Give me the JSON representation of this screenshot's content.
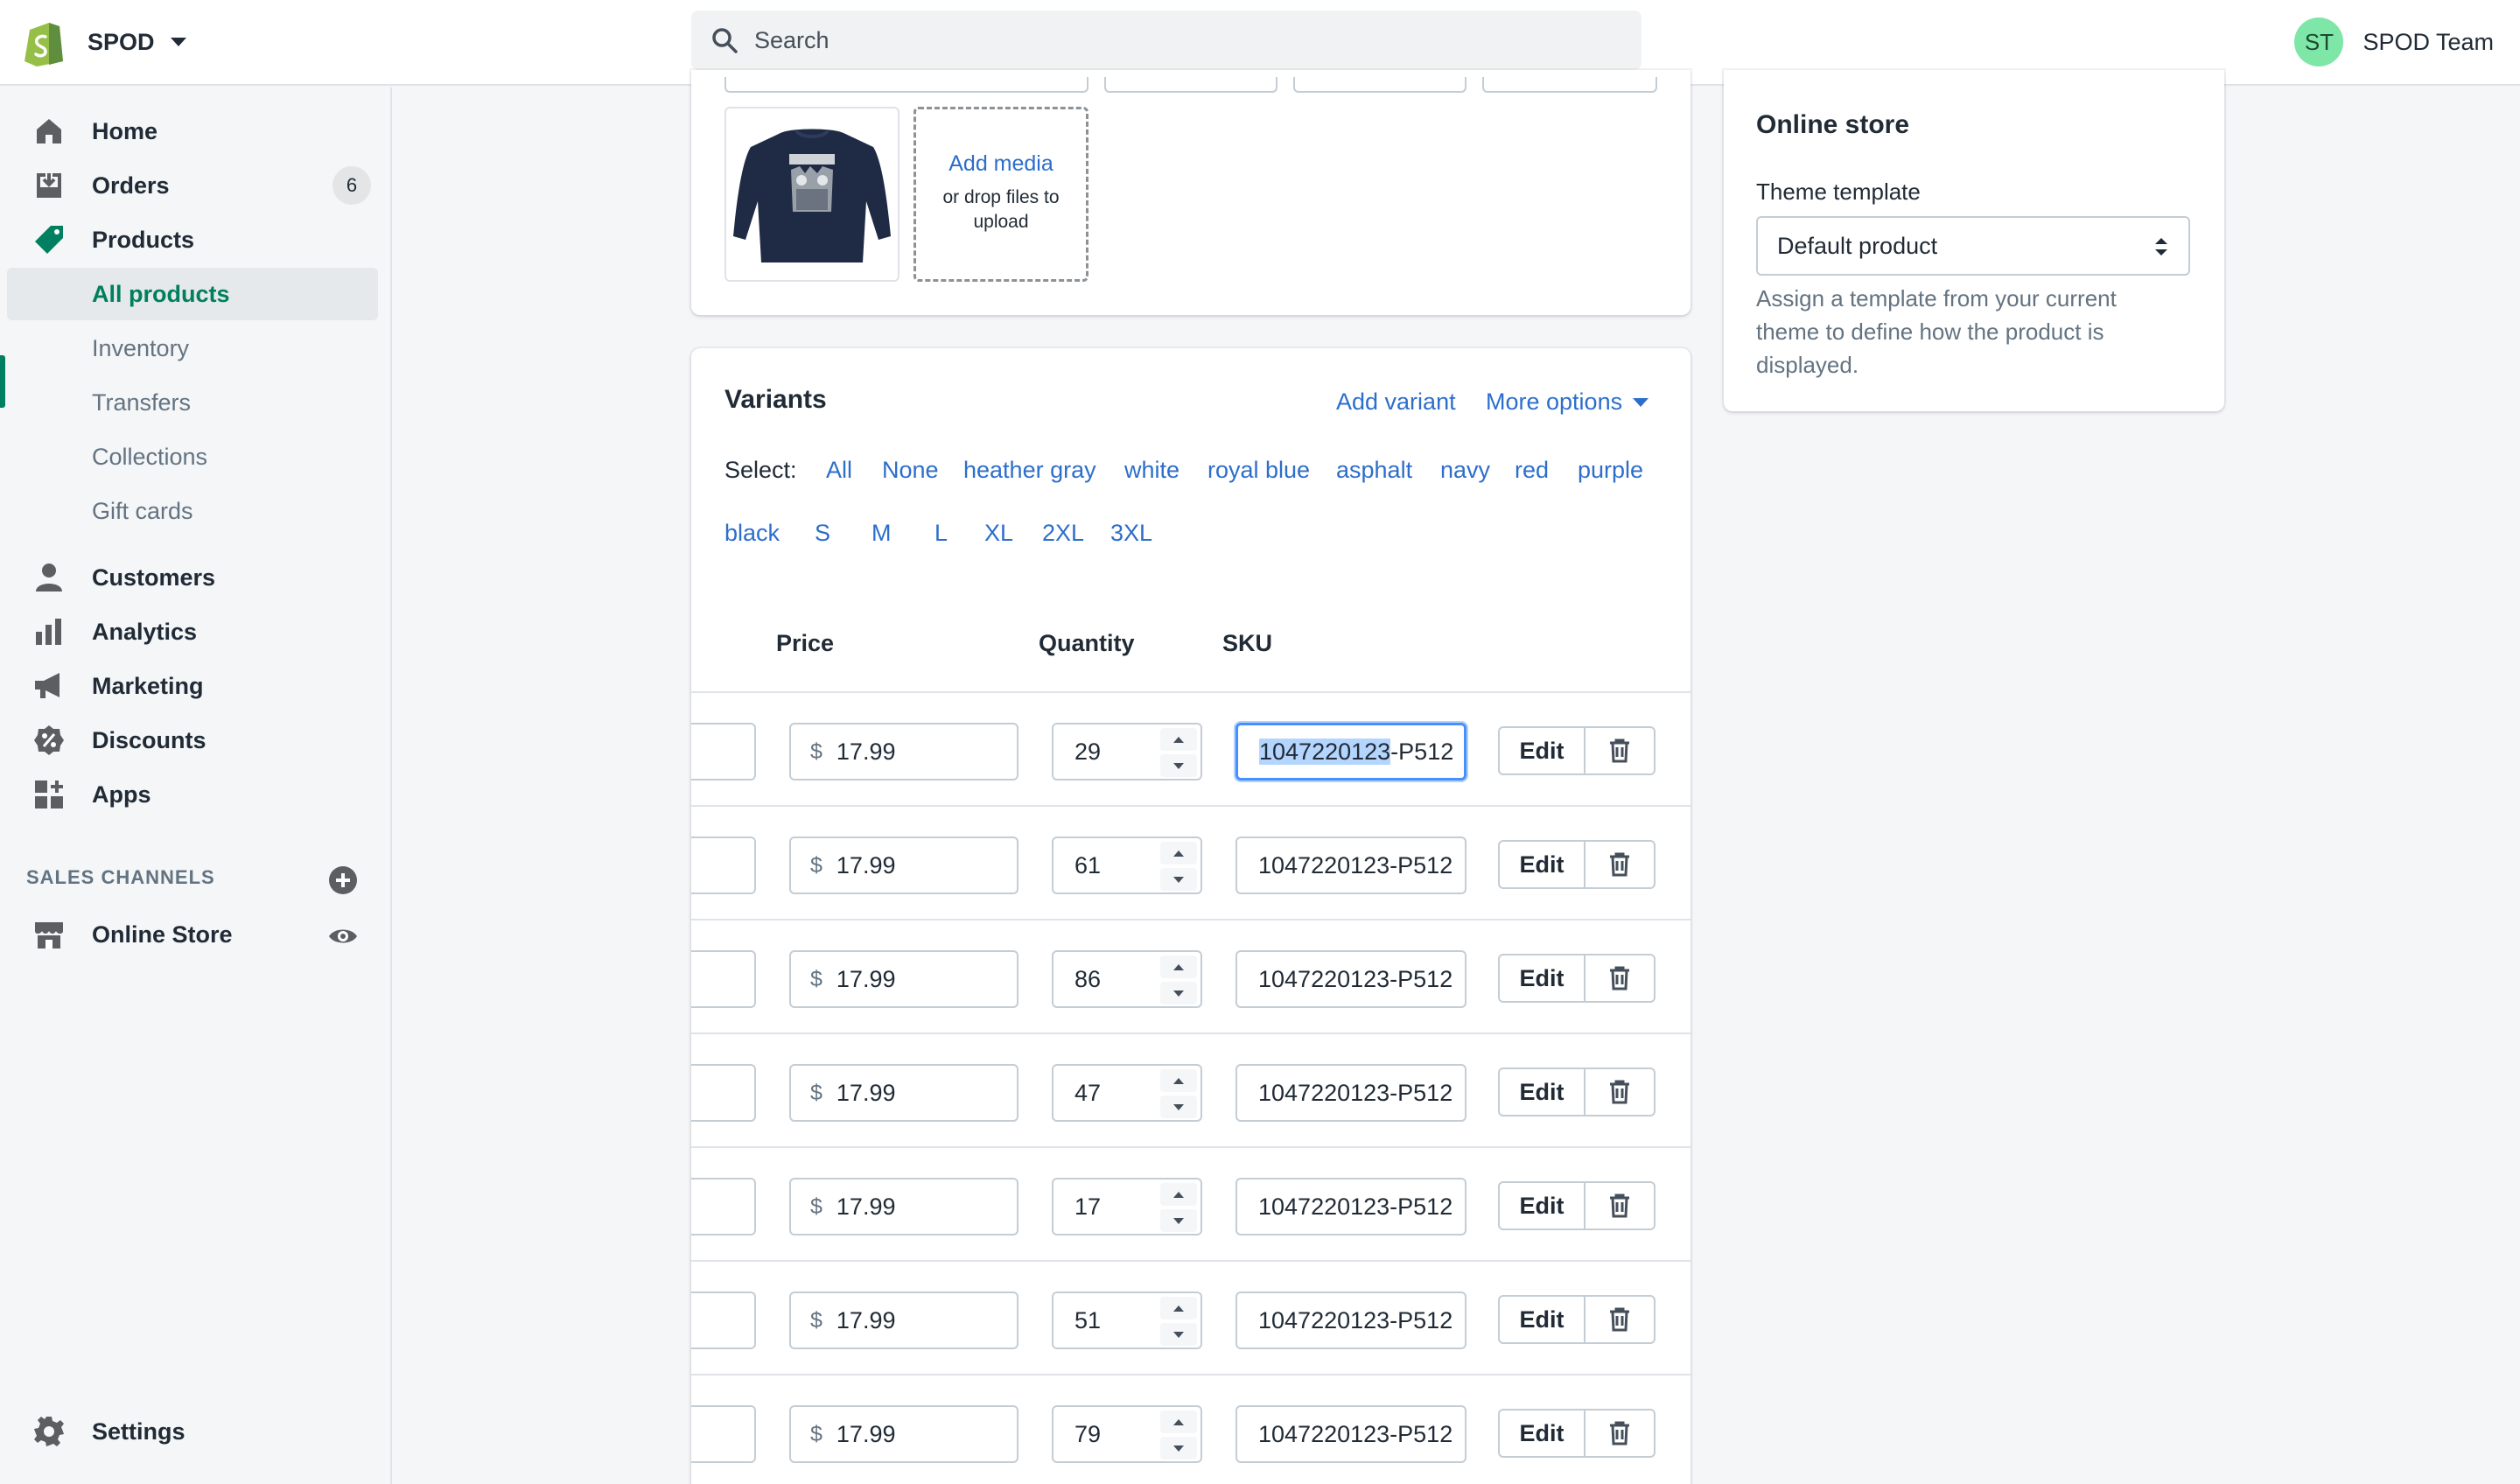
{
  "topbar": {
    "store_name": "SPOD",
    "search_placeholder": "Search",
    "user_initials": "ST",
    "user_name": "SPOD Team"
  },
  "sidebar": {
    "home": "Home",
    "orders": "Orders",
    "orders_badge": "6",
    "products": "Products",
    "sub": {
      "all_products": "All products",
      "inventory": "Inventory",
      "transfers": "Transfers",
      "collections": "Collections",
      "gift_cards": "Gift cards"
    },
    "customers": "Customers",
    "analytics": "Analytics",
    "marketing": "Marketing",
    "discounts": "Discounts",
    "apps": "Apps",
    "sales_channels_heading": "SALES CHANNELS",
    "online_store": "Online Store",
    "settings": "Settings"
  },
  "media": {
    "add_media": "Add media",
    "drop_hint": "or drop files to upload"
  },
  "variants": {
    "title": "Variants",
    "add_variant": "Add variant",
    "more_options": "More options",
    "select_label": "Select:",
    "select_options": [
      "All",
      "None",
      "heather gray",
      "white",
      "royal blue",
      "asphalt",
      "navy",
      "red",
      "purple",
      "black",
      "S",
      "M",
      "L",
      "XL",
      "2XL",
      "3XL"
    ],
    "columns": {
      "price": "Price",
      "quantity": "Quantity",
      "sku": "SKU"
    },
    "currency": "$",
    "edit_label": "Edit",
    "rows": [
      {
        "price": "17.99",
        "quantity": "29",
        "sku_selected": "1047220123",
        "sku_rest": "-P512"
      },
      {
        "price": "17.99",
        "quantity": "61",
        "sku": "1047220123-P512"
      },
      {
        "price": "17.99",
        "quantity": "86",
        "sku": "1047220123-P512"
      },
      {
        "price": "17.99",
        "quantity": "47",
        "sku": "1047220123-P512"
      },
      {
        "price": "17.99",
        "quantity": "17",
        "sku": "1047220123-P512"
      },
      {
        "price": "17.99",
        "quantity": "51",
        "sku": "1047220123-P512"
      },
      {
        "price": "17.99",
        "quantity": "79",
        "sku": "1047220123-P512"
      }
    ]
  },
  "online_store": {
    "title": "Online store",
    "theme_label": "Theme template",
    "theme_value": "Default product",
    "help": "Assign a template from your current theme to define how the product is displayed."
  },
  "colors": {
    "accent_green": "#008060",
    "link_blue": "#2c6ecb",
    "focus_blue": "#458fff"
  }
}
